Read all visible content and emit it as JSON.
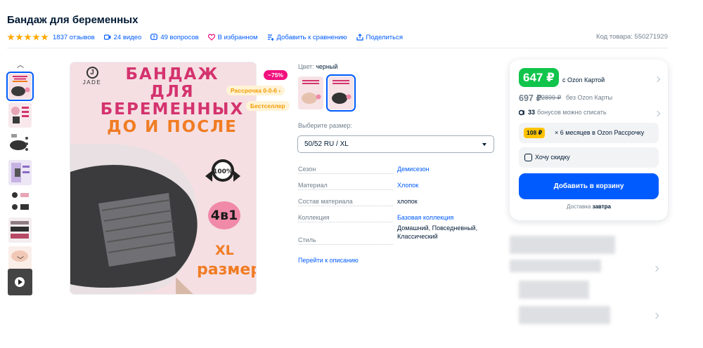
{
  "product": {
    "title": "Бандаж для беременных",
    "rating_stars": 5,
    "reviews": "1837 отзывов",
    "videos": "24 видео",
    "questions": "49 вопросов",
    "favorite": "В избранном",
    "compare": "Добавить к сравнению",
    "share": "Поделиться",
    "sku": "Код товара: 550271929"
  },
  "image": {
    "brand": "JADE",
    "brand_letter": "J",
    "headline": [
      "БАНДАЖ",
      "ДЛЯ",
      "БЕРЕМЕННЫХ",
      "ДО И ПОСЛЕ"
    ],
    "badge": "4в1",
    "size_line1": "XL",
    "size_line2": "размер",
    "discount_tag": "−75%",
    "installment_tag": "Рассрочка 0-0-6 ›",
    "bestseller_tag": "Бестселлер"
  },
  "options": {
    "color_label": "Цвет:",
    "color_value": "черный",
    "size_label": "Выберите размер:",
    "size_value": "50/52 RU / XL"
  },
  "properties": [
    {
      "key": "Сезон",
      "value": "Демисезон"
    },
    {
      "key": "Материал",
      "value": "Хлопок"
    },
    {
      "key": "Состав материала",
      "value": "хлопок"
    },
    {
      "key": "Коллекция",
      "value": "Базовая коллекция"
    },
    {
      "key": "Стиль",
      "value": "Домашний, Повседневный, Классический"
    }
  ],
  "go_to_description": "Перейти к описанию",
  "price": {
    "card_price": "647 ₽",
    "card_label": "с Ozon Картой",
    "price": "697 ₽",
    "old_price": "2899 ₽",
    "no_card_label": "без Ozon Карты",
    "bonus_count": "33",
    "bonus_text": "бонусов можно списать",
    "installment_amount": "108 ₽",
    "installment_text": "× 6 месяцев в Ozon Рассрочку",
    "want_discount": "Хочу скидку",
    "add_to_cart": "Добавить в корзину",
    "delivery_label": "Доставка",
    "delivery_value": "завтра"
  },
  "colors": {
    "accent": "#005bff",
    "price_green": "#10c44c",
    "star": "#ffa800",
    "discount_pink": "#f1117e",
    "headline_pink": "#d4336e",
    "headline_orange": "#f07c23"
  }
}
